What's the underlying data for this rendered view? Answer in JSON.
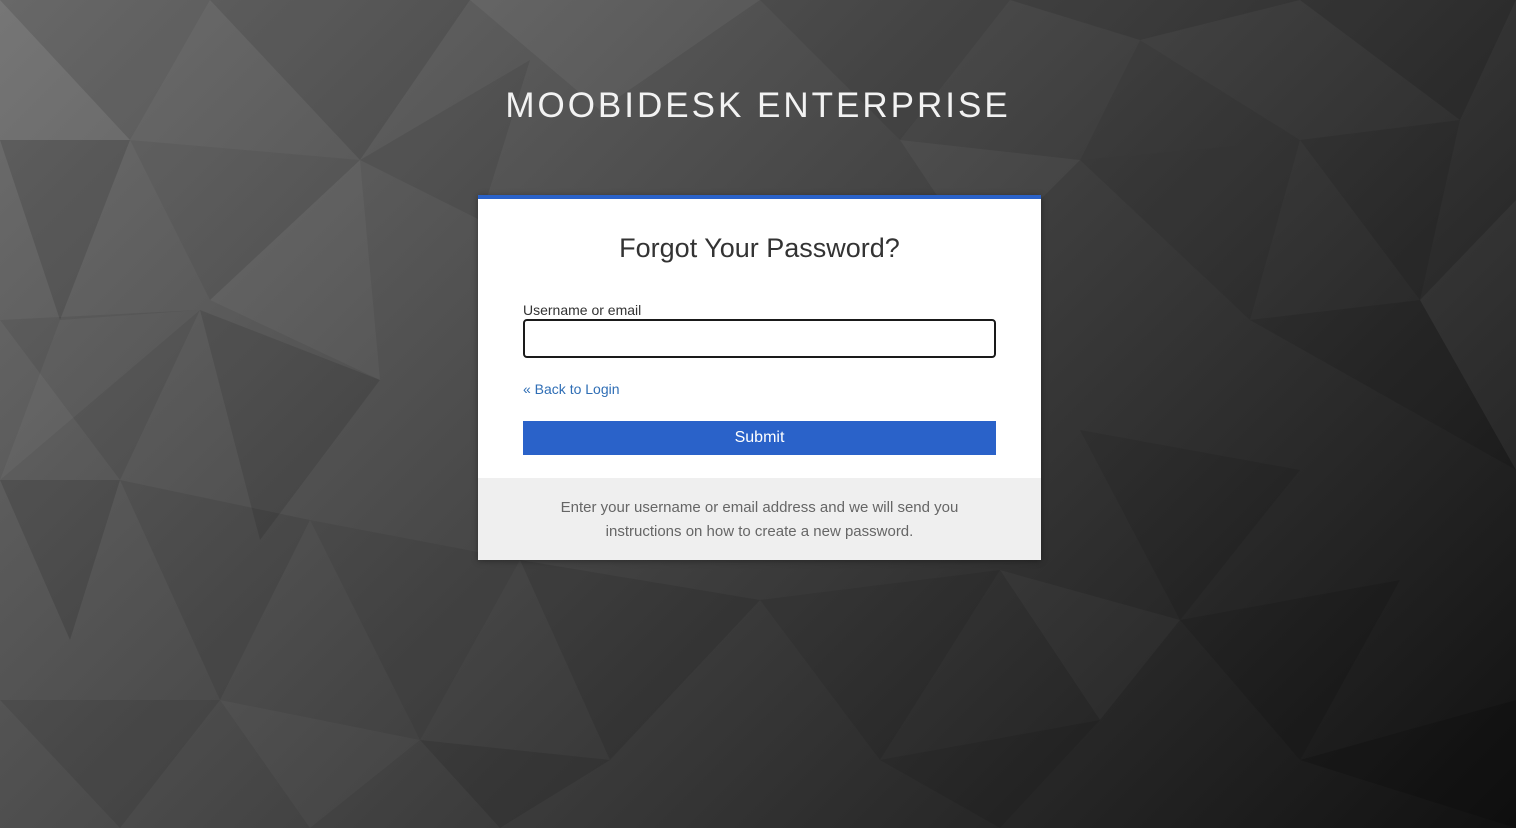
{
  "brand": {
    "title": "MOOBIDESK ENTERPRISE"
  },
  "form": {
    "heading": "Forgot Your Password?",
    "username_label": "Username or email",
    "username_value": "",
    "back_link": "« Back to Login",
    "submit_label": "Submit"
  },
  "footer": {
    "info": "Enter your username or email address and we will send you instructions on how to create a new password."
  },
  "colors": {
    "accent": "#2a62c9",
    "link": "#2f6eb5"
  }
}
